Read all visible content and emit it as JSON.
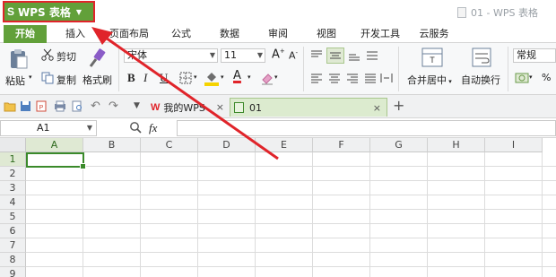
{
  "titlebar": {
    "app_logo": "S",
    "app_name": "WPS 表格",
    "window_title": "01 - WPS 表格"
  },
  "ribbon_tabs": [
    "开始",
    "插入",
    "页面布局",
    "公式",
    "数据",
    "审阅",
    "视图",
    "开发工具",
    "云服务"
  ],
  "ribbon": {
    "paste_label": "粘贴",
    "cut_label": "剪切",
    "copy_label": "复制",
    "format_painter_label": "格式刷",
    "font_name": "宋体",
    "font_size": "11",
    "bold": "B",
    "italic": "I",
    "underline": "U",
    "increase_font": "A",
    "decrease_font": "A",
    "font_color_letter": "A",
    "merge_label": "合并居中",
    "wrap_label": "自动换行",
    "number_format": "常规",
    "percent": "%",
    "accent_color": "#62a03a",
    "highlight_color": "#e0242a"
  },
  "doc_tabs": [
    {
      "label": "我的WPS",
      "active": false
    },
    {
      "label": "01",
      "active": true
    }
  ],
  "formula_bar": {
    "cell_ref": "A1",
    "fx_label": "fx",
    "value": ""
  },
  "sheet": {
    "columns": [
      "A",
      "B",
      "C",
      "D",
      "E",
      "F",
      "G",
      "H",
      "I"
    ],
    "rows": [
      "1",
      "2",
      "3",
      "4",
      "5",
      "6",
      "7",
      "8",
      "9"
    ],
    "selected_cell": "A1"
  },
  "annotation": {
    "type": "red-arrow",
    "color": "#e0242a",
    "points_to": "app-menu-button"
  }
}
